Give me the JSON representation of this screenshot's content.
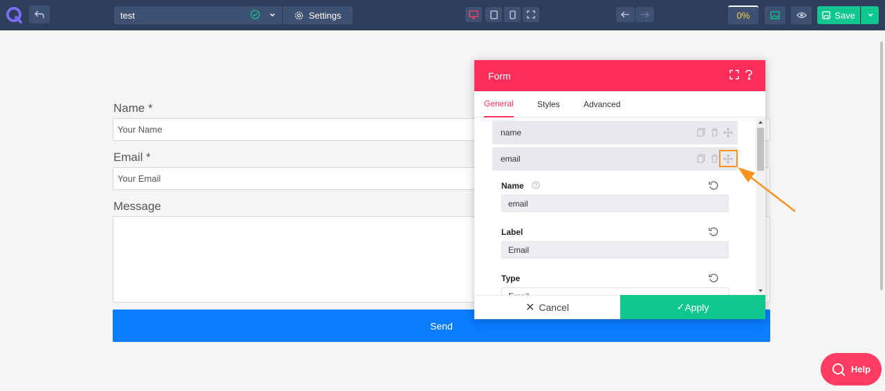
{
  "toolbar": {
    "page_name": "test",
    "settings_label": "Settings",
    "progress": "0%",
    "save_label": "Save"
  },
  "form": {
    "fields": [
      {
        "label": "Name *",
        "placeholder": "Your Name"
      },
      {
        "label": "Email *",
        "placeholder": "Your Email"
      },
      {
        "label": "Message",
        "placeholder": ""
      }
    ],
    "submit_label": "Send"
  },
  "panel": {
    "title": "Form",
    "tabs": [
      "General",
      "Styles",
      "Advanced"
    ],
    "active_tab": "General",
    "items": [
      {
        "label": "name"
      },
      {
        "label": "email"
      }
    ],
    "controls": [
      {
        "label": "Name",
        "value": "email"
      },
      {
        "label": "Label",
        "value": "Email"
      },
      {
        "label": "Type",
        "value": "Email"
      }
    ],
    "cancel_label": "Cancel",
    "apply_label": "Apply"
  },
  "help": {
    "label": "Help"
  },
  "colors": {
    "toolbar_bg": "#2d3e5c",
    "panel_accent": "#ff2d59",
    "apply_green": "#10c78e",
    "send_blue": "#0a7cff",
    "annotation_orange": "#f7931e"
  },
  "icons": [
    "logo-icon",
    "undo-icon",
    "check-circle-icon",
    "chevron-down-icon",
    "gear-icon",
    "desktop-icon",
    "tablet-icon",
    "mobile-icon",
    "fullscreen-icon",
    "arrow-left-icon",
    "arrow-right-icon",
    "image-icon",
    "eye-icon",
    "save-icon",
    "help-circle-icon",
    "duplicate-icon",
    "trash-icon",
    "move-icon",
    "reset-icon",
    "close-icon",
    "checkmark-icon",
    "search-icon"
  ]
}
